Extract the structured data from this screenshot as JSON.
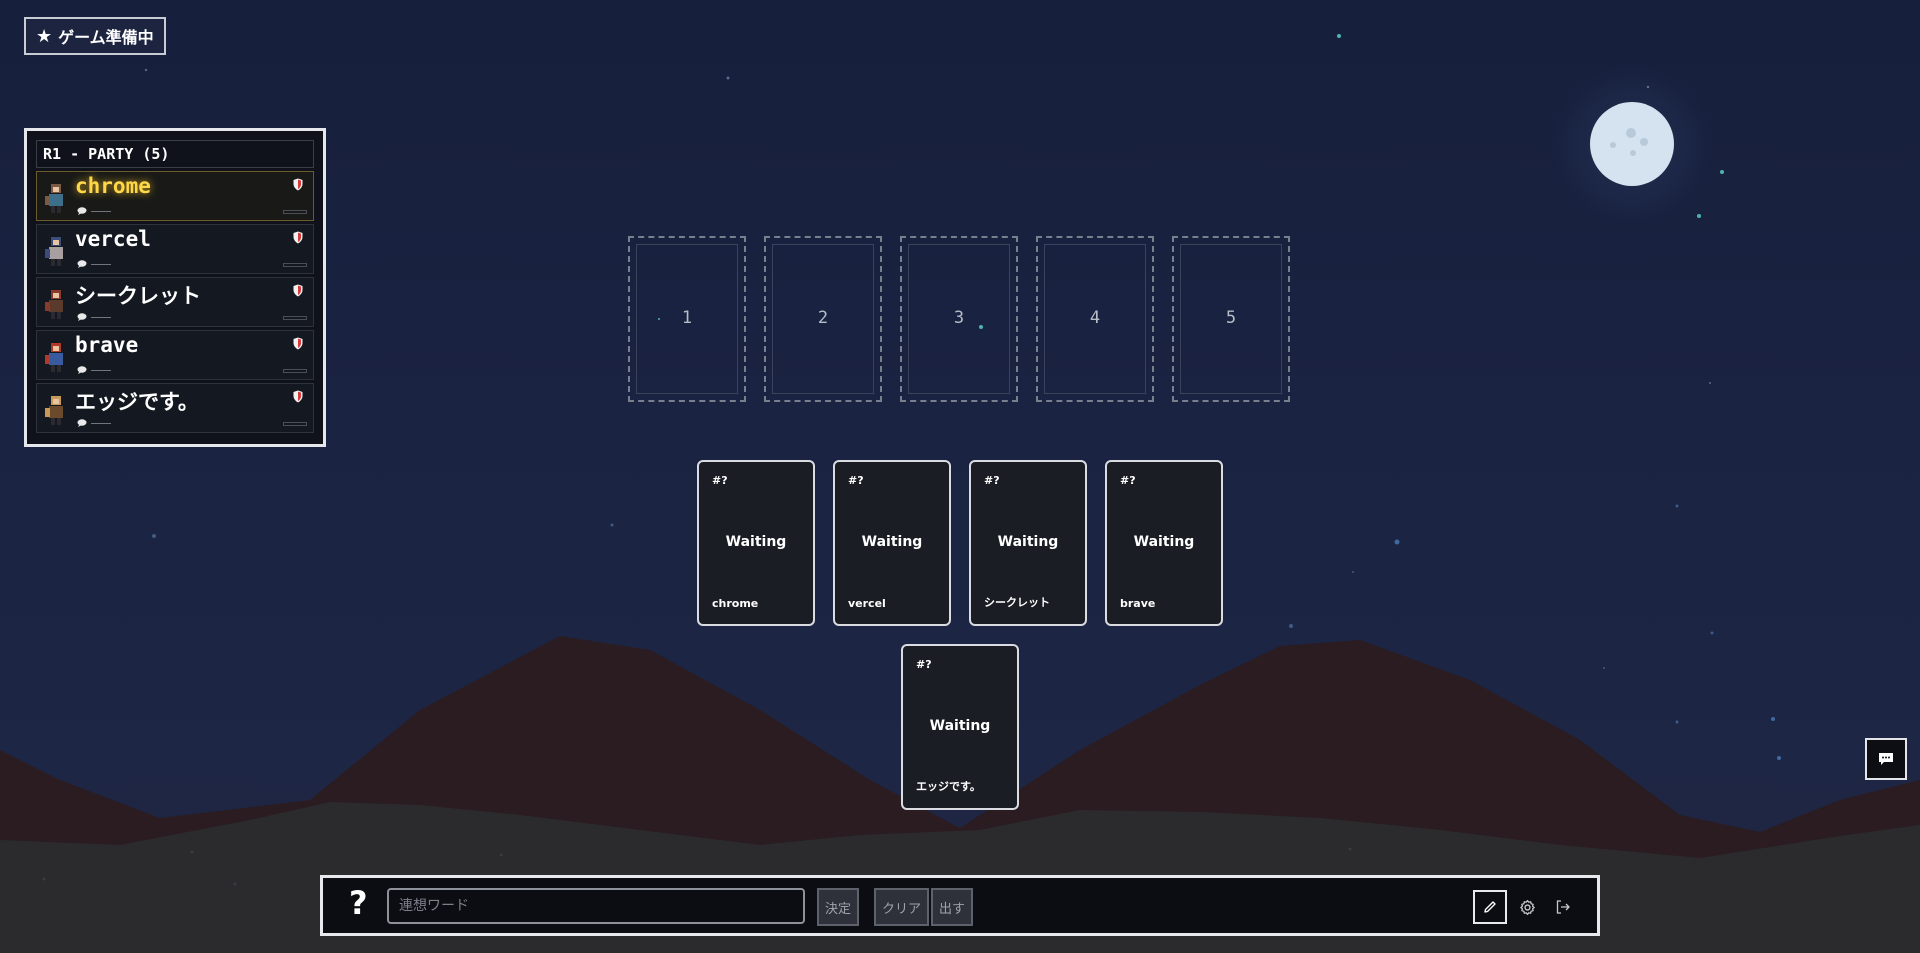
{
  "status_badge": {
    "icon": "star-icon",
    "label": "ゲーム準備中"
  },
  "party": {
    "header": "R1 - PARTY (5)",
    "members": [
      {
        "name": "chrome",
        "active": true
      },
      {
        "name": "vercel",
        "active": false
      },
      {
        "name": "シークレット",
        "active": false
      },
      {
        "name": "brave",
        "active": false
      },
      {
        "name": "エッジです。",
        "active": false
      }
    ]
  },
  "slots": [
    "1",
    "2",
    "3",
    "4",
    "5"
  ],
  "cards": [
    {
      "number": "#?",
      "status": "Waiting",
      "owner": "chrome"
    },
    {
      "number": "#?",
      "status": "Waiting",
      "owner": "vercel"
    },
    {
      "number": "#?",
      "status": "Waiting",
      "owner": "シークレット"
    },
    {
      "number": "#?",
      "status": "Waiting",
      "owner": "brave"
    },
    {
      "number": "#?",
      "status": "Waiting",
      "owner": "エッジです。"
    }
  ],
  "toolbar": {
    "help_label": "?",
    "word_placeholder": "連想ワード",
    "word_value": "",
    "decide_label": "決定",
    "clear_label": "クリア",
    "submit_label": "出す",
    "icons": [
      "pencil-icon",
      "gear-icon",
      "logout-icon"
    ]
  },
  "chat": {
    "icon": "chat-icon"
  },
  "colors": {
    "sky": "#161f3b",
    "mountain_far": "#2a1c20",
    "mountain_near": "#2b2b2e",
    "active_name": "#ffd84a",
    "moon": "#d5e3f0"
  }
}
